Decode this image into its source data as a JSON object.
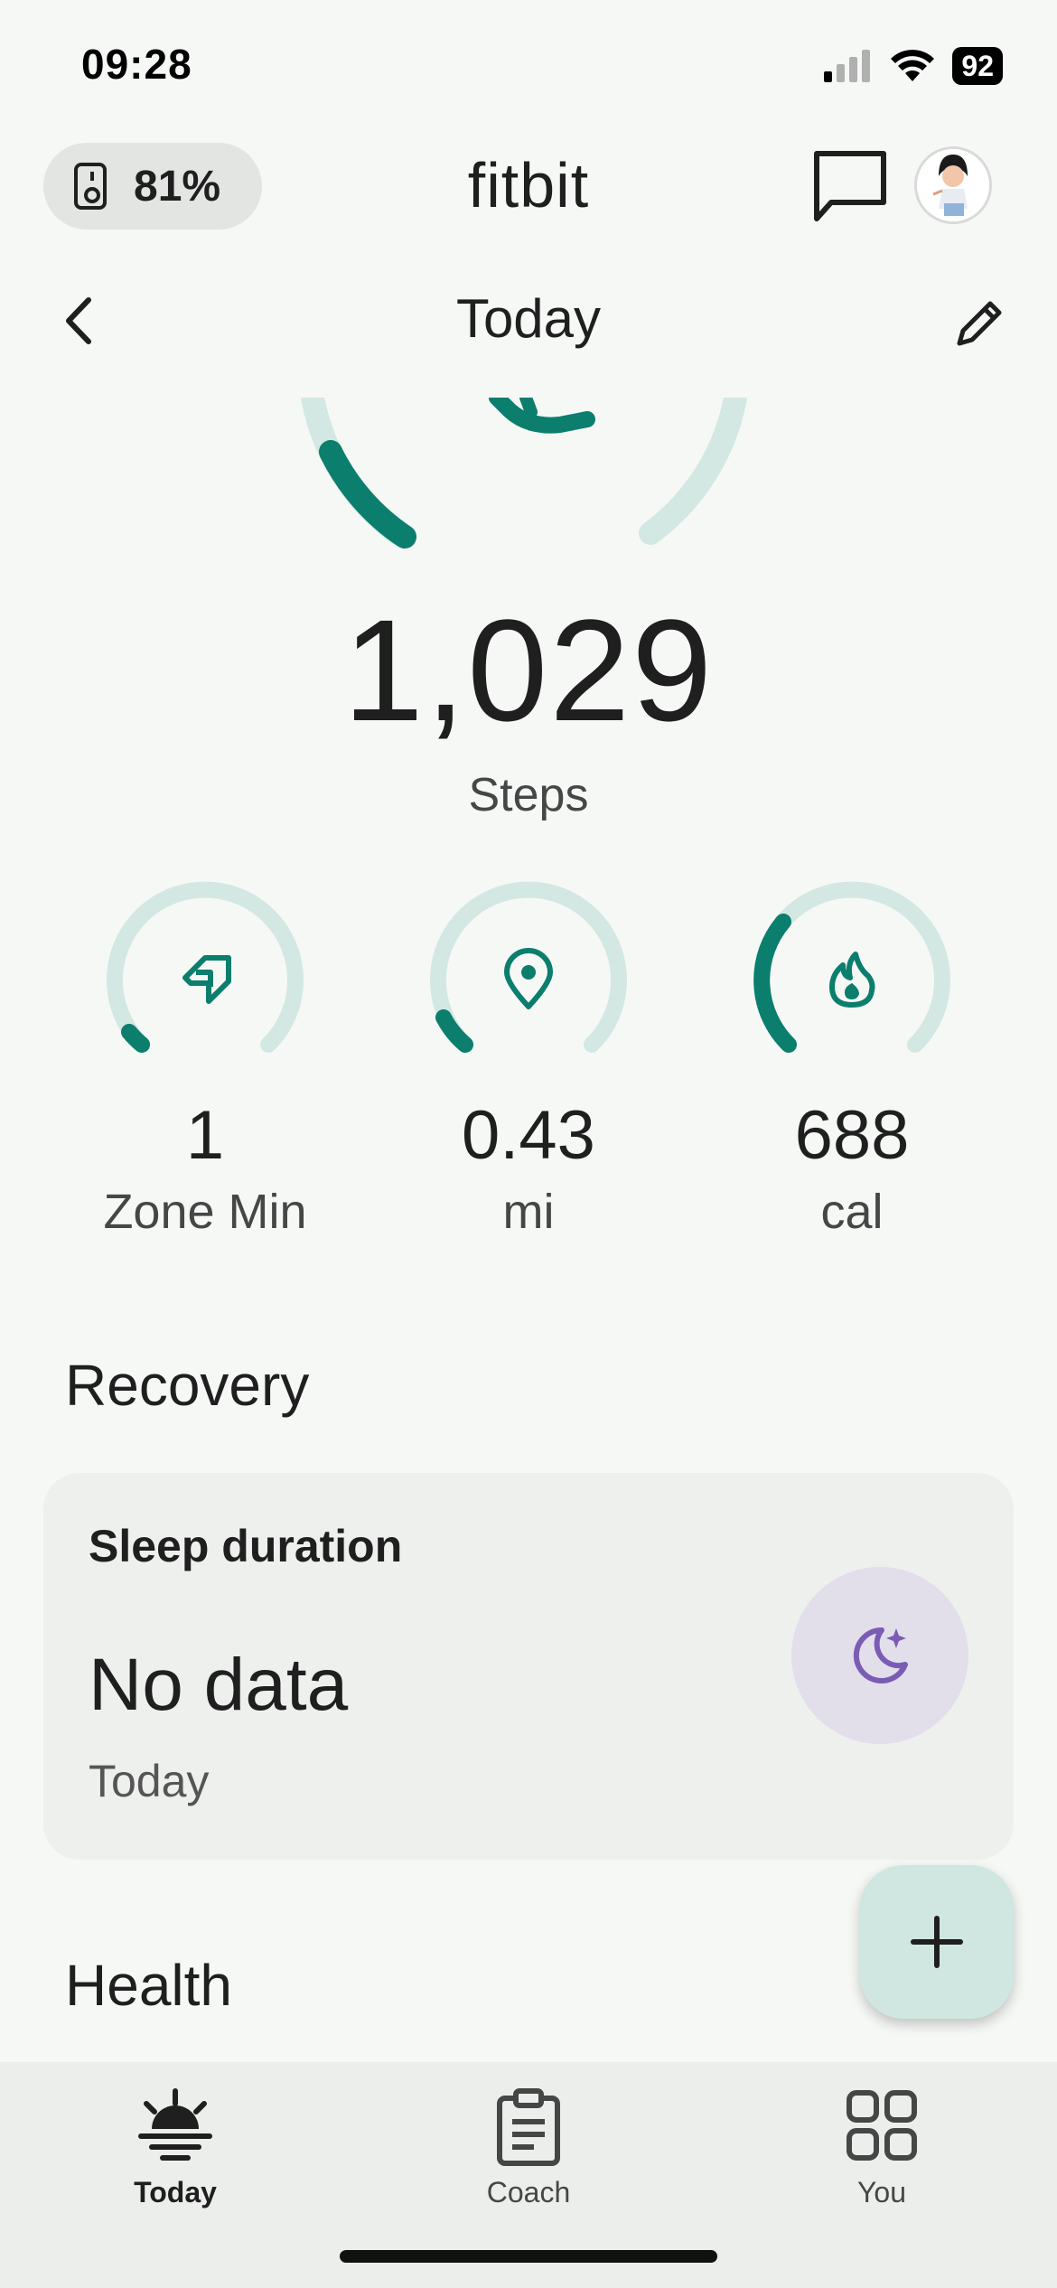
{
  "status_bar": {
    "time": "09:28",
    "battery": "92"
  },
  "header": {
    "device_battery": "81%",
    "app_title": "fitbit"
  },
  "nav": {
    "title": "Today"
  },
  "steps": {
    "value": "1,029",
    "label": "Steps"
  },
  "metrics": [
    {
      "value": "1",
      "label": "Zone Min",
      "icon": "zone-arrow-icon",
      "progress": 0.05
    },
    {
      "value": "0.43",
      "label": "mi",
      "icon": "location-pin-icon",
      "progress": 0.08
    },
    {
      "value": "688",
      "label": "cal",
      "icon": "flame-icon",
      "progress": 0.3
    }
  ],
  "recovery": {
    "heading": "Recovery",
    "card_title": "Sleep duration",
    "card_value": "No data",
    "card_sub": "Today"
  },
  "health": {
    "heading": "Health"
  },
  "bottom_nav": {
    "items": [
      {
        "label": "Today",
        "icon": "sunrise-icon",
        "active": true
      },
      {
        "label": "Coach",
        "icon": "clipboard-icon",
        "active": false
      },
      {
        "label": "You",
        "icon": "grid-icon",
        "active": false
      }
    ]
  },
  "colors": {
    "accent": "#0b7e6d",
    "accent_light": "#d3e8e3",
    "sleep_purple": "#7a5cb5",
    "sleep_bg": "#e2dfeb"
  }
}
